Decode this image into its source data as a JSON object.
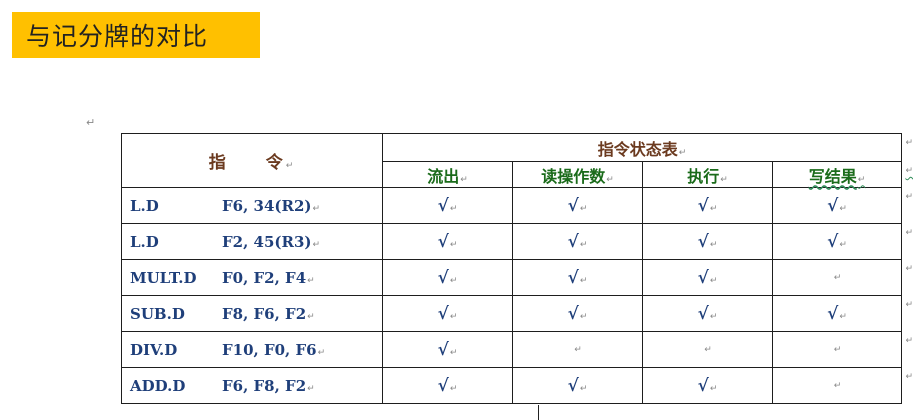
{
  "title": "与记分牌的对比",
  "paragraph_mark": "↵",
  "table": {
    "instr_header": "指　　令",
    "status_header": "指令状态表",
    "columns": [
      "流出",
      "读操作数",
      "执行",
      "写结果"
    ],
    "check_symbol": "√",
    "rows": [
      {
        "op": "L.D",
        "args": "F6, 34(R2)",
        "status": [
          true,
          true,
          true,
          true
        ]
      },
      {
        "op": "L.D",
        "args": "F2, 45(R3)",
        "status": [
          true,
          true,
          true,
          true
        ]
      },
      {
        "op": "MULT.D",
        "args": "F0, F2, F4",
        "status": [
          true,
          true,
          true,
          false
        ]
      },
      {
        "op": "SUB.D",
        "args": "F8, F6, F2",
        "status": [
          true,
          true,
          true,
          true
        ]
      },
      {
        "op": "DIV.D",
        "args": "F10, F0, F6",
        "status": [
          true,
          false,
          false,
          false
        ]
      },
      {
        "op": "ADD.D",
        "args": "F6, F8, F2",
        "status": [
          true,
          true,
          true,
          false
        ]
      }
    ]
  },
  "colors": {
    "title_bg": "#FFC000",
    "header_text": "#6b3a1f",
    "column_header_text": "#1a6b1a",
    "body_text": "#1f3f7a"
  }
}
